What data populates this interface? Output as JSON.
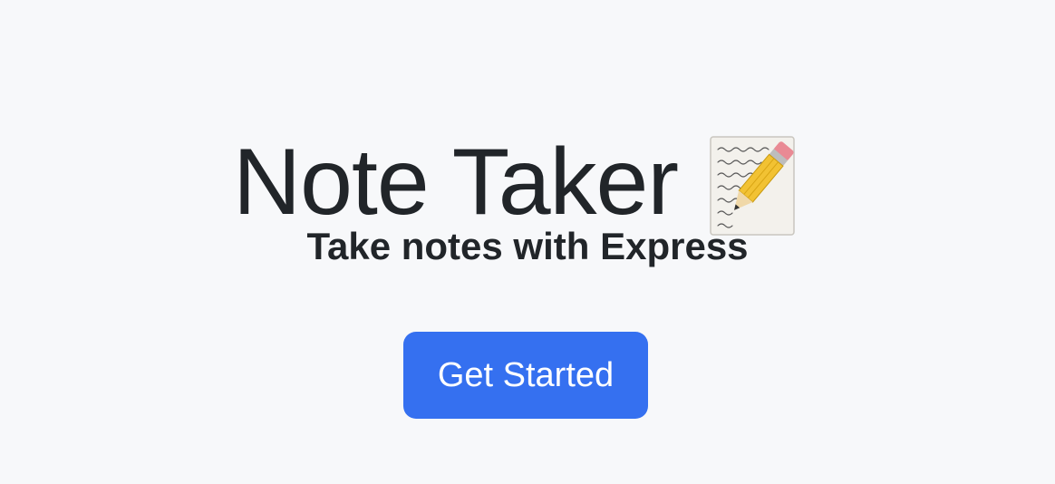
{
  "hero": {
    "title": "Note Taker",
    "title_icon": "memo-pencil-icon",
    "subtitle": "Take notes with Express",
    "cta_label": "Get Started"
  },
  "colors": {
    "background": "#f7f8fa",
    "text": "#212529",
    "accent": "#3570f0",
    "button_text": "#ffffff"
  }
}
